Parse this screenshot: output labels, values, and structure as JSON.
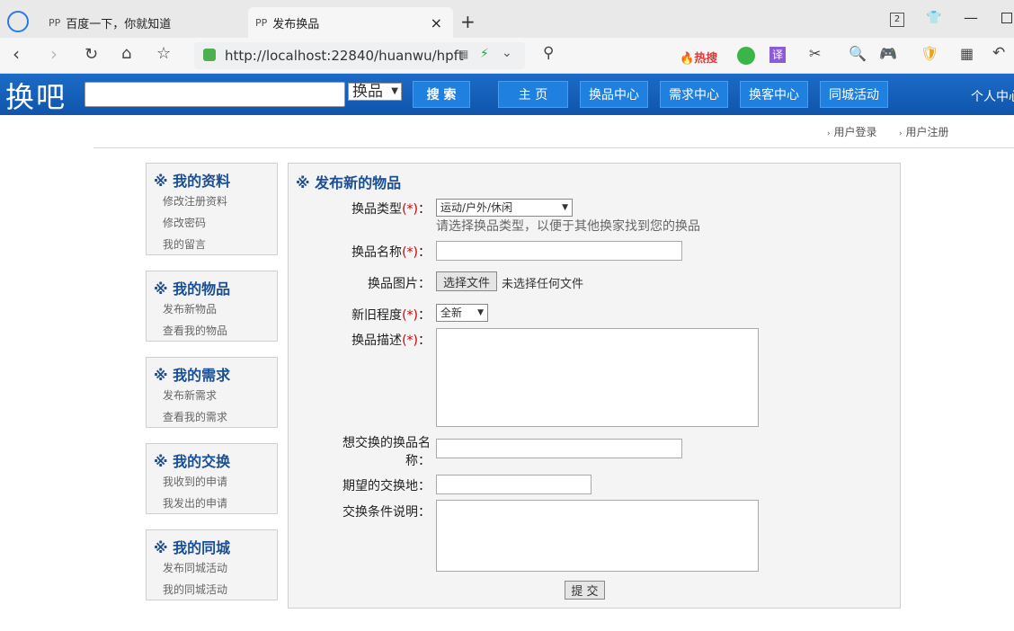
{
  "browser": {
    "tabs": [
      {
        "title": "百度一下，你就知道",
        "active": false
      },
      {
        "title": "发布换品",
        "active": true
      }
    ],
    "new_tab": "+",
    "url": "http://localhost:22840/huanwu/hpft",
    "hot_search": "热搜",
    "translate": "译",
    "tab_count": "2"
  },
  "site": {
    "logo": "换吧",
    "search_placeholder": "",
    "search_scope": "换品",
    "search_button": "搜 索",
    "nav": [
      "主 页",
      "换品中心",
      "需求中心",
      "换客中心",
      "同城活动",
      "个人中心"
    ],
    "login": "用户登录",
    "register": "用户注册"
  },
  "sidebar": [
    {
      "title": "※ 我的资料",
      "items": [
        "修改注册资料",
        "修改密码",
        "我的留言"
      ]
    },
    {
      "title": "※ 我的物品",
      "items": [
        "发布新物品",
        "查看我的物品"
      ]
    },
    {
      "title": "※ 我的需求",
      "items": [
        "发布新需求",
        "查看我的需求"
      ]
    },
    {
      "title": "※ 我的交换",
      "items": [
        "我收到的申请",
        "我发出的申请"
      ]
    },
    {
      "title": "※ 我的同城",
      "items": [
        "发布同城活动",
        "我的同城活动"
      ]
    }
  ],
  "form": {
    "title": "※ 发布新的物品",
    "type_label": "换品类型",
    "type_value": "运动/户外/休闲",
    "type_hint": "请选择换品类型，以便于其他换家找到您的换品",
    "name_label": "换品名称",
    "image_label": "换品图片",
    "file_button": "选择文件",
    "file_status": "未选择任何文件",
    "condition_label": "新旧程度",
    "condition_value": "全新",
    "desc_label": "换品描述",
    "want_label_1": "想交换的换品名",
    "want_label_2": "称：",
    "place_label": "期望的交换地：",
    "terms_label": "交换条件说明：",
    "submit": "提 交",
    "required_mark": "(*)",
    "colon": "："
  }
}
